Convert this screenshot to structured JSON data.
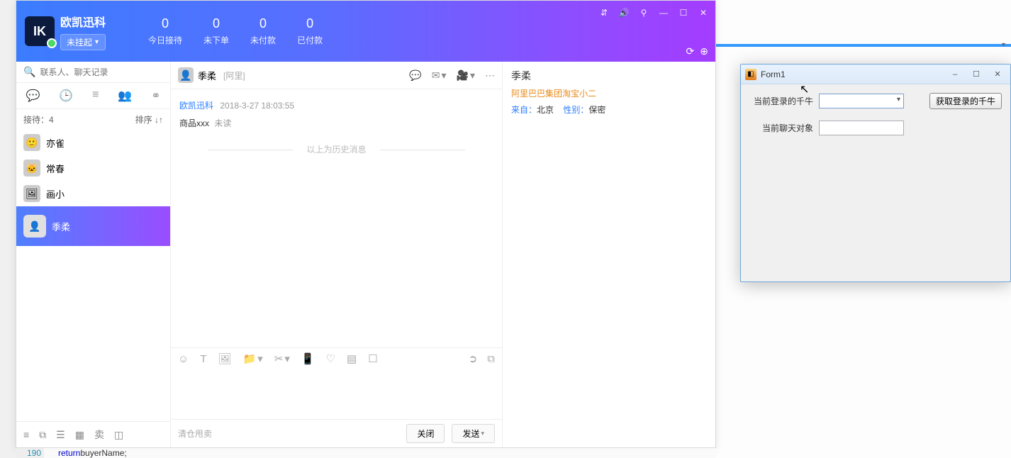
{
  "header": {
    "app_title": "欧凯迅科",
    "status": "未挂起",
    "stats": [
      {
        "num": "0",
        "label": "今日接待"
      },
      {
        "num": "0",
        "label": "未下单"
      },
      {
        "num": "0",
        "label": "未付款"
      },
      {
        "num": "0",
        "label": "已付款"
      }
    ]
  },
  "sidebar": {
    "search_placeholder": "联系人、聊天记录",
    "receive_label": "接待：4",
    "sort_label": "排序 ↓↑",
    "contacts": [
      {
        "name": "亦雀"
      },
      {
        "name": "常春"
      },
      {
        "name": "画小"
      },
      {
        "name": "季柔"
      }
    ],
    "bottom_sell": "卖"
  },
  "chat": {
    "name": "季柔",
    "source": "[阿里]",
    "msg_sender": "欧凯迅科",
    "msg_time": "2018-3-27 18:03:55",
    "msg_text": "商品xxx",
    "msg_status": "未读",
    "history_sep": "以上为历史消息",
    "qing_cang": "清仓甩卖",
    "btn_close": "关闭",
    "btn_send": "发送"
  },
  "right": {
    "name": "季柔",
    "company": "阿里巴巴集团淘宝小二",
    "from_label": "来自：",
    "from_val": "北京",
    "gender_label": "性别：",
    "gender_val": "保密"
  },
  "form1": {
    "title": "Form1",
    "label_login": "当前登录的千牛",
    "label_chat": "当前聊天对象",
    "btn_fetch": "获取登录的千牛"
  },
  "ide": {
    "line_no": "190",
    "code_kw": "return",
    "code_rest": " buyerName;"
  }
}
